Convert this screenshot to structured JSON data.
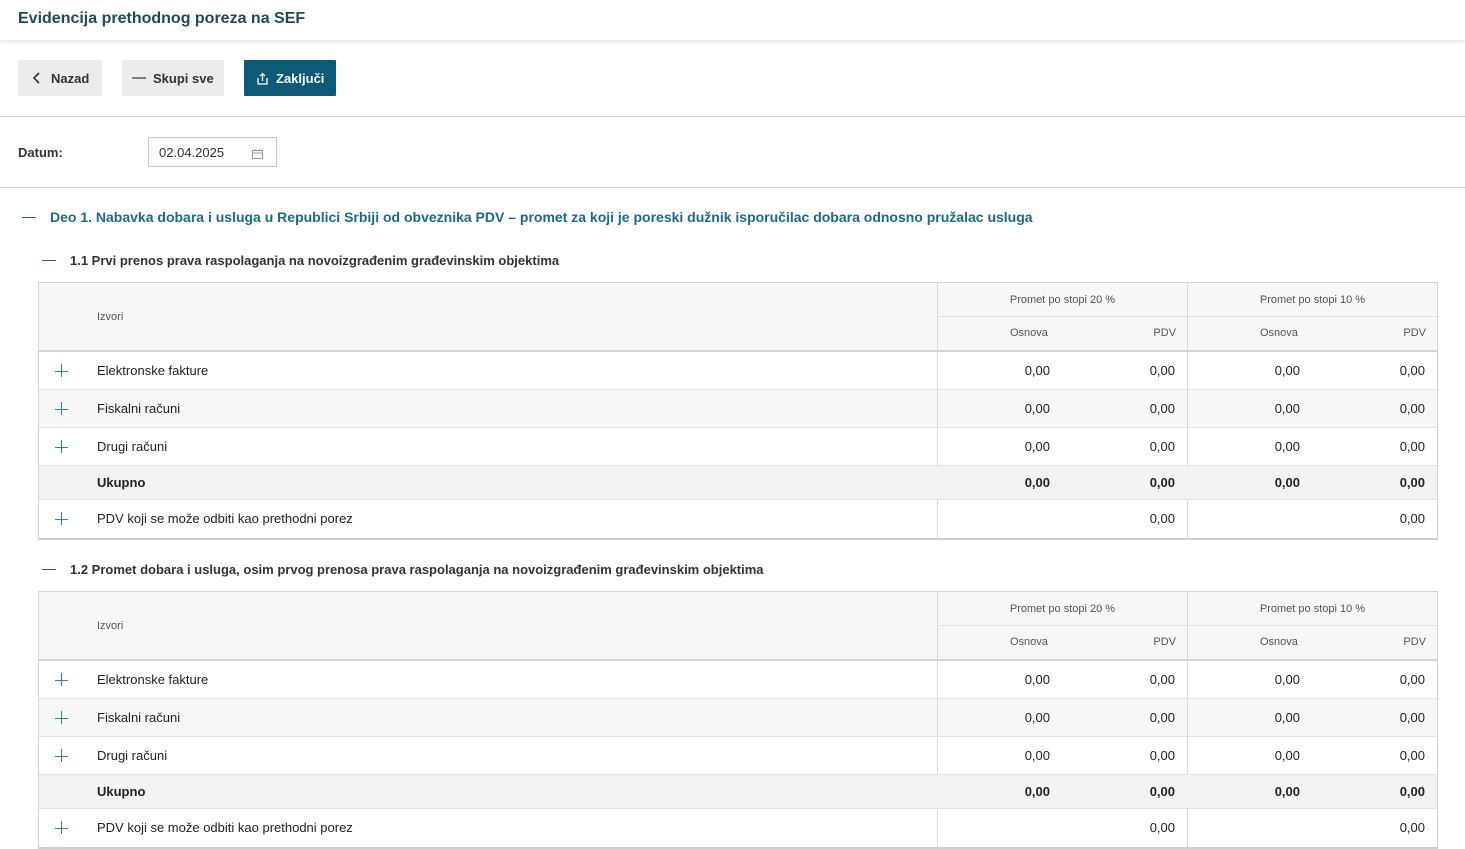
{
  "header": {
    "title": "Evidencija prethodnog poreza na SEF"
  },
  "toolbar": {
    "back_label": "Nazad",
    "collapse_label": "Skupi sve",
    "lock_label": "Zaključi"
  },
  "date": {
    "label": "Datum:",
    "value": "02.04.2025"
  },
  "part1": {
    "title": "Deo 1. Nabavka dobara i usluga u Republici Srbiji od obveznika PDV – promet za koji je poreski dužnik isporučilac dobara odnosno pružalac usluga"
  },
  "sections": [
    {
      "title": "1.1 Prvi prenos prava raspolaganja na novoizgrađenim građevinskim objektima",
      "headers": {
        "source": "Izvori",
        "group20": "Promet po stopi 20 %",
        "group10": "Promet po stopi 10 %",
        "base": "Osnova",
        "vat": "PDV"
      },
      "rows": [
        {
          "label": "Elektronske fakture",
          "b20": "0,00",
          "v20": "0,00",
          "b10": "0,00",
          "v10": "0,00"
        },
        {
          "label": "Fiskalni računi",
          "b20": "0,00",
          "v20": "0,00",
          "b10": "0,00",
          "v10": "0,00"
        },
        {
          "label": "Drugi računi",
          "b20": "0,00",
          "v20": "0,00",
          "b10": "0,00",
          "v10": "0,00"
        },
        {
          "label": "Ukupno",
          "b20": "0,00",
          "v20": "0,00",
          "b10": "0,00",
          "v10": "0,00"
        },
        {
          "label": "PDV koji se može odbiti kao prethodni porez",
          "v20": "0,00",
          "v10": "0,00"
        }
      ]
    },
    {
      "title": "1.2 Promet dobara i usluga, osim prvog prenosa prava raspolaganja na novoizgrađenim građevinskim objektima",
      "headers": {
        "source": "Izvori",
        "group20": "Promet po stopi 20 %",
        "group10": "Promet po stopi 10 %",
        "base": "Osnova",
        "vat": "PDV"
      },
      "rows": [
        {
          "label": "Elektronske fakture",
          "b20": "0,00",
          "v20": "0,00",
          "b10": "0,00",
          "v10": "0,00"
        },
        {
          "label": "Fiskalni računi",
          "b20": "0,00",
          "v20": "0,00",
          "b10": "0,00",
          "v10": "0,00"
        },
        {
          "label": "Drugi računi",
          "b20": "0,00",
          "v20": "0,00",
          "b10": "0,00",
          "v10": "0,00"
        },
        {
          "label": "Ukupno",
          "b20": "0,00",
          "v20": "0,00",
          "b10": "0,00",
          "v10": "0,00"
        },
        {
          "label": "PDV koji se može odbiti kao prethodni porez",
          "v20": "0,00",
          "v10": "0,00"
        }
      ]
    }
  ]
}
